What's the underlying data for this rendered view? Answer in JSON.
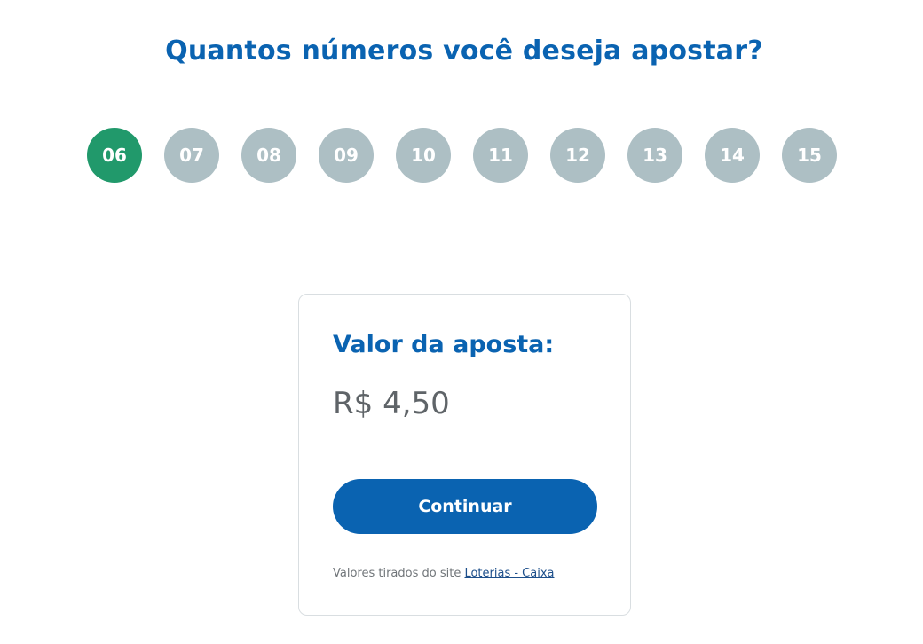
{
  "question": "Quantos números você deseja apostar?",
  "numbers": [
    {
      "label": "06",
      "selected": true
    },
    {
      "label": "07",
      "selected": false
    },
    {
      "label": "08",
      "selected": false
    },
    {
      "label": "09",
      "selected": false
    },
    {
      "label": "10",
      "selected": false
    },
    {
      "label": "11",
      "selected": false
    },
    {
      "label": "12",
      "selected": false
    },
    {
      "label": "13",
      "selected": false
    },
    {
      "label": "14",
      "selected": false
    },
    {
      "label": "15",
      "selected": false
    }
  ],
  "card": {
    "title": "Valor da aposta:",
    "value": "R$ 4,50",
    "button_label": "Continuar",
    "source_text": "Valores tirados do site",
    "source_link": "Loterias - Caixa"
  },
  "colors": {
    "primary": "#0a63b1",
    "selected": "#21996b",
    "unselected": "#adbfc4"
  }
}
